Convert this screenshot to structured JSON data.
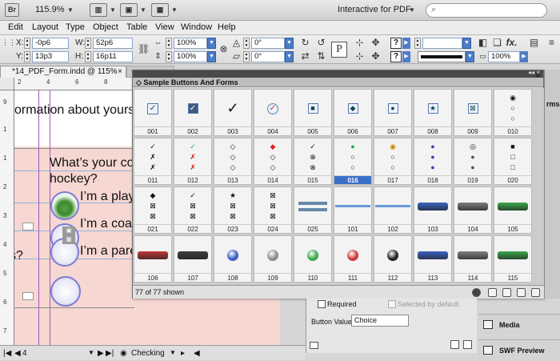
{
  "app": {
    "logo": "Br",
    "zoom": "115.9%",
    "workspace": "Interactive for PDF",
    "search_placeholder": ""
  },
  "menu": [
    "Edit",
    "Layout",
    "Type",
    "Object",
    "Table",
    "View",
    "Window",
    "Help"
  ],
  "control": {
    "x_label": "X:",
    "x_value": "-0p6",
    "y_label": "Y:",
    "y_value": "13p3",
    "w_label": "W:",
    "w_value": "52p6",
    "h_label": "H:",
    "h_value": "16p11",
    "scale_x": "100%",
    "scale_y": "100%",
    "angle": "0°",
    "shear": "0°",
    "stroke_pct": "100%"
  },
  "document": {
    "tab_title": "*14_PDF_Form.indd @ 115%",
    "ruler_h": [
      "2",
      "4",
      "6",
      "8"
    ],
    "ruler_v": [
      "9",
      "1",
      "1",
      "2",
      "3",
      "4",
      "5",
      "6",
      "7",
      "8"
    ],
    "text_top": "ormation about yourse",
    "text_q1": "What’s your con",
    "text_q2": "hockey?",
    "opt1": "I’m a playe",
    "opt2": "I’m a coac",
    "opt3": "I’m a pare",
    "edge_text": "s?"
  },
  "palette": {
    "title": "Sample Buttons And Forms",
    "rows": [
      [
        "001",
        "002",
        "003",
        "004",
        "005",
        "006",
        "007",
        "008",
        "009",
        "010"
      ],
      [
        "011",
        "012",
        "013",
        "014",
        "015",
        "016",
        "017",
        "018",
        "019",
        "020"
      ],
      [
        "021",
        "022",
        "023",
        "024",
        "025",
        "101",
        "102",
        "103",
        "104",
        "105"
      ],
      [
        "106",
        "107",
        "108",
        "109",
        "110",
        "111",
        "112",
        "113",
        "114",
        "115"
      ]
    ],
    "selected": "016",
    "status": "77 of 77 shown"
  },
  "buttons_panel": {
    "required_label": "Required",
    "selected_default": "Selected by default",
    "button_value_label": "Button Value:",
    "button_value": "Choice"
  },
  "right_panel": {
    "items": [
      "Media",
      "SWF Preview"
    ],
    "peek_text": "rms"
  },
  "statusbar": {
    "page": "4",
    "preflight": "Checking"
  }
}
